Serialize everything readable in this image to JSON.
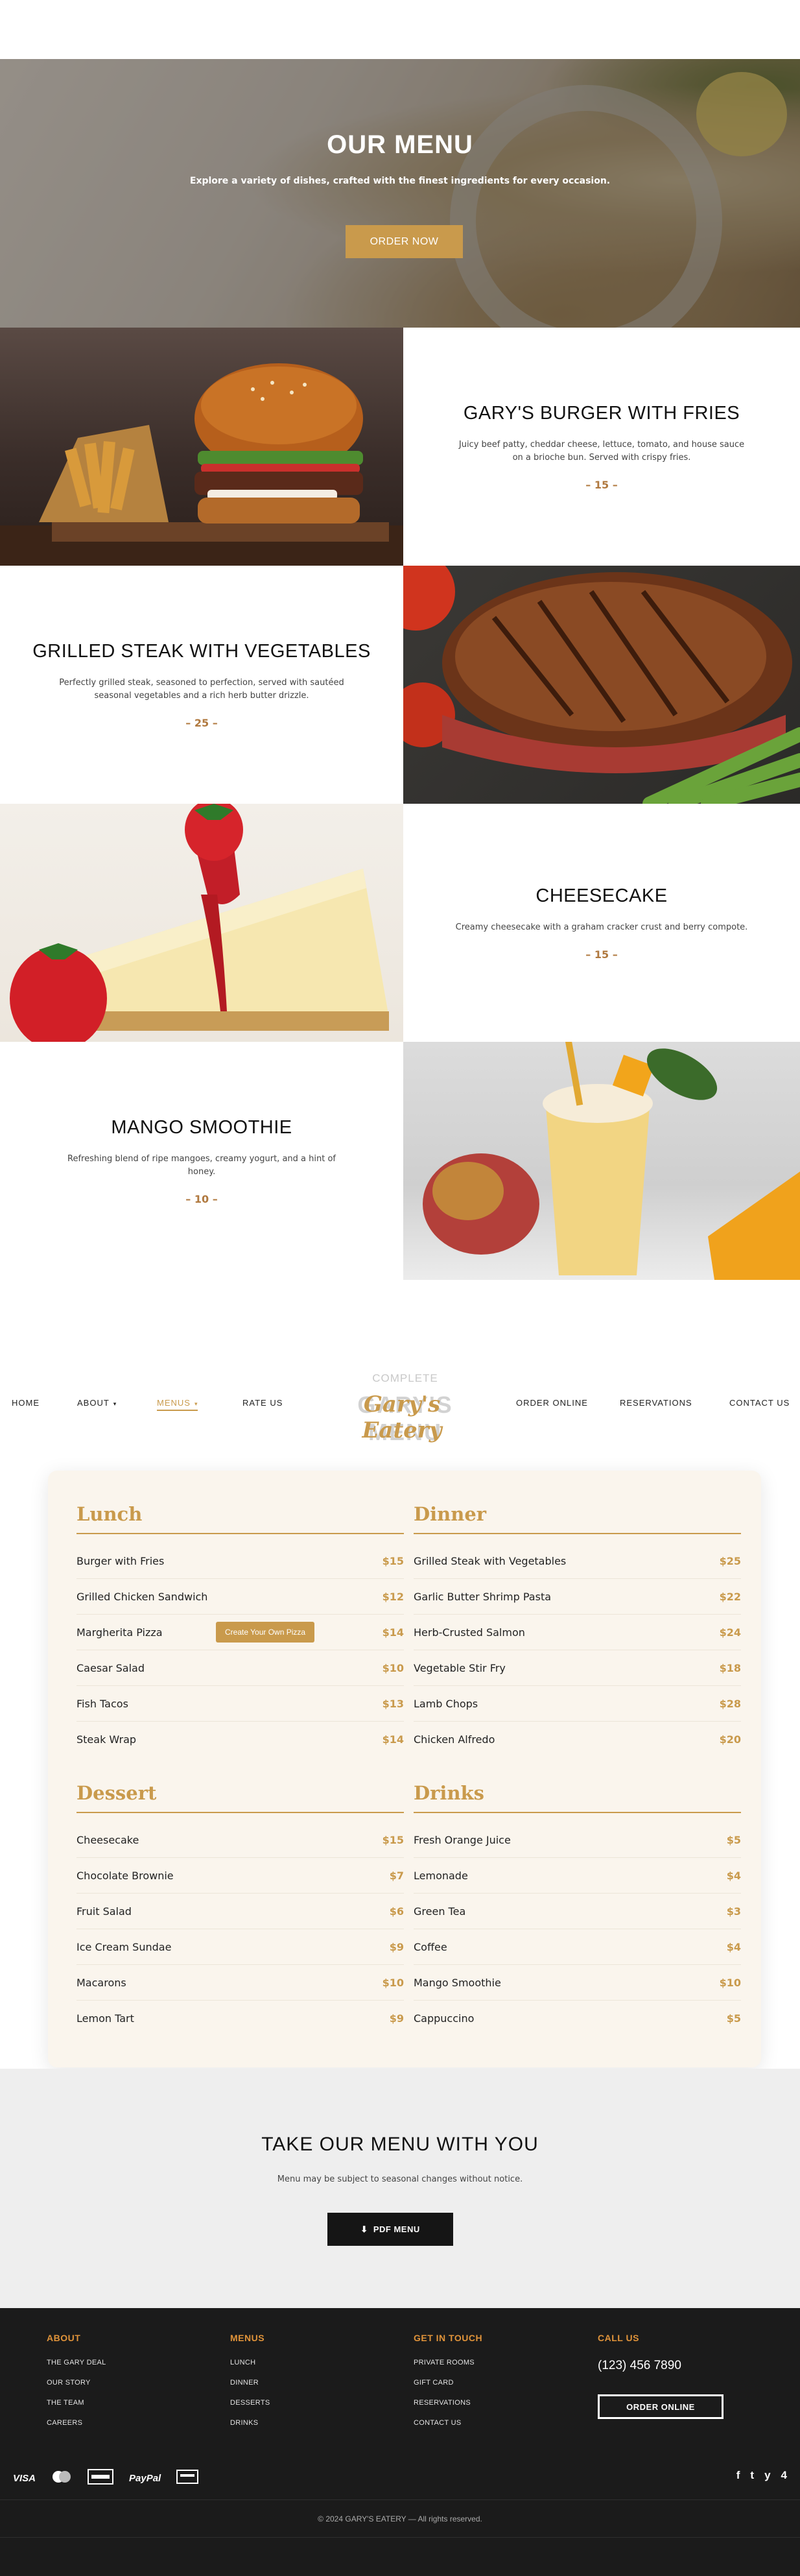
{
  "hero": {
    "title": "OUR MENU",
    "subtitle": "Explore a variety of dishes, crafted with the finest ingredients for every occasion.",
    "button": "ORDER NOW"
  },
  "dishes": [
    {
      "name": "GARY'S BURGER WITH FRIES",
      "desc": "Juicy beef patty, cheddar cheese, lettuce, tomato, and house sauce on a brioche bun. Served with crispy fries.",
      "price": "– 15 –"
    },
    {
      "name": "GRILLED STEAK WITH VEGETABLES",
      "desc": "Perfectly grilled steak, seasoned to perfection, served with sautéed seasonal vegetables and a rich herb butter drizzle.",
      "price": "– 25 –"
    },
    {
      "name": "CHEESECAKE",
      "desc": "Creamy cheesecake with a graham cracker crust and berry compote.",
      "price": "– 15 –"
    },
    {
      "name": "MANGO SMOOTHIE",
      "desc": "Refreshing blend of ripe mangoes, creamy yogurt, and a hint of honey.",
      "price": "– 10 –"
    }
  ],
  "ghost": {
    "complete": "COMPLETE",
    "menu": "GARY'S MENU"
  },
  "nav": {
    "home": "HOME",
    "about": "ABOUT",
    "menus": "MENUS",
    "rate": "RATE US",
    "logo": "Gary's Eatery",
    "order": "ORDER ONLINE",
    "reservations": "RESERVATIONS",
    "contact": "CONTACT US",
    "caret": "▾"
  },
  "menu": {
    "lunch": {
      "heading": "Lunch",
      "items": [
        {
          "name": "Burger with Fries",
          "price": "$15"
        },
        {
          "name": "Grilled Chicken Sandwich",
          "price": "$12"
        },
        {
          "name": "Margherita Pizza",
          "price": "$14"
        },
        {
          "name": "Caesar Salad",
          "price": "$10"
        },
        {
          "name": "Fish Tacos",
          "price": "$13"
        },
        {
          "name": "Steak Wrap",
          "price": "$14"
        }
      ]
    },
    "dinner": {
      "heading": "Dinner",
      "items": [
        {
          "name": "Grilled Steak with Vegetables",
          "price": "$25"
        },
        {
          "name": "Garlic Butter Shrimp Pasta",
          "price": "$22"
        },
        {
          "name": "Herb-Crusted Salmon",
          "price": "$24"
        },
        {
          "name": "Vegetable Stir Fry",
          "price": "$18"
        },
        {
          "name": "Lamb Chops",
          "price": "$28"
        },
        {
          "name": "Chicken Alfredo",
          "price": "$20"
        }
      ]
    },
    "dessert": {
      "heading": "Dessert",
      "items": [
        {
          "name": "Cheesecake",
          "price": "$15"
        },
        {
          "name": "Chocolate Brownie",
          "price": "$7"
        },
        {
          "name": "Fruit Salad",
          "price": "$6"
        },
        {
          "name": "Ice Cream Sundae",
          "price": "$9"
        },
        {
          "name": "Macarons",
          "price": "$10"
        },
        {
          "name": "Lemon Tart",
          "price": "$9"
        }
      ]
    },
    "drinks": {
      "heading": "Drinks",
      "items": [
        {
          "name": "Fresh Orange Juice",
          "price": "$5"
        },
        {
          "name": "Lemonade",
          "price": "$4"
        },
        {
          "name": "Green Tea",
          "price": "$3"
        },
        {
          "name": "Coffee",
          "price": "$4"
        },
        {
          "name": "Mango Smoothie",
          "price": "$10"
        },
        {
          "name": "Cappuccino",
          "price": "$5"
        }
      ]
    },
    "pizza_tooltip": "Create Your Own Pizza"
  },
  "take": {
    "title": "TAKE OUR MENU WITH YOU",
    "subtitle": "Menu may be subject to seasonal changes without notice.",
    "button": "PDF MENU"
  },
  "footer": {
    "about": {
      "heading": "ABOUT",
      "links": [
        "THE GARY DEAL",
        "OUR STORY",
        "THE TEAM",
        "CAREERS"
      ]
    },
    "menus": {
      "heading": "MENUS",
      "links": [
        "LUNCH",
        "DINNER",
        "DESSERTS",
        "DRINKS"
      ]
    },
    "touch": {
      "heading": "GET IN TOUCH",
      "links": [
        "PRIVATE ROOMS",
        "GIFT CARD",
        "RESERVATIONS",
        "CONTACT US"
      ]
    },
    "call": {
      "heading": "CALL US",
      "phone": "(123) 456 7890",
      "button": "ORDER ONLINE"
    },
    "payments": [
      "VISA",
      "PayPal"
    ],
    "social": [
      "f",
      "t",
      "y",
      "4"
    ],
    "copyright": "© 2024 GARY'S EATERY — All rights reserved."
  },
  "colors": {
    "accent": "#c99a4c",
    "footer_accent": "#e0933a",
    "footer_bg": "#1b1b1b",
    "menu_bg": "#faf5ed"
  }
}
